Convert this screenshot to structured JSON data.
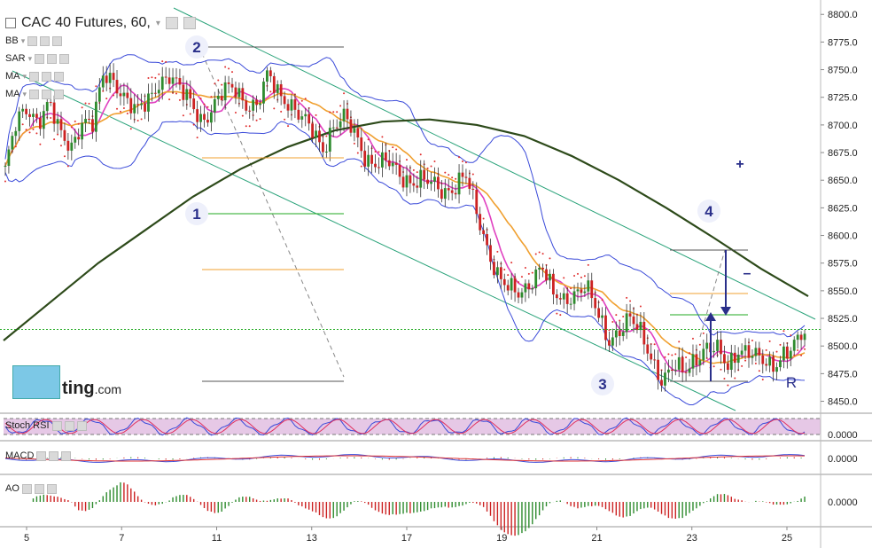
{
  "header": {
    "title": "CAC 40 Futures, 60,",
    "indicators": [
      "BB",
      "SAR",
      "MA",
      "MA"
    ]
  },
  "panes": {
    "stoch_label": "Stoch RSI",
    "macd_label": "MACD",
    "ao_label": "AO",
    "stoch_value": "0.0000",
    "macd_value": "0.0000",
    "ao_value": "0.0000"
  },
  "watermark": {
    "text": "ting",
    "suffix": ".com"
  },
  "annotations": {
    "wave1": "1",
    "wave2": "2",
    "wave3": "3",
    "wave4": "4",
    "plus": "+",
    "minus": "–",
    "r": "R"
  },
  "colors": {
    "candle_up": "#2e8b2e",
    "candle_down": "#cc2222",
    "bb": "#3a4ad9",
    "sar": "#e03030",
    "ma_fast": "#e040c0",
    "ma_mid": "#f0a030",
    "ma_slow": "#2d4a1a",
    "channel": "#2aa37a",
    "price_line": "#22aa22"
  },
  "chart_data": {
    "type": "candlestick",
    "x_ticks": [
      "5",
      "7",
      "11",
      "13",
      "17",
      "19",
      "21",
      "23",
      "25"
    ],
    "y_ticks": [
      "8800.0",
      "8775.0",
      "8750.0",
      "8725.0",
      "8700.0",
      "8675.0",
      "8650.0",
      "8625.0",
      "8600.0",
      "8575.0",
      "8550.0",
      "8525.0",
      "8500.0",
      "8475.0",
      "8450.0"
    ],
    "ylim": [
      8440,
      8805
    ],
    "close_path": [
      8660,
      8700,
      8715,
      8705,
      8720,
      8690,
      8680,
      8705,
      8700,
      8745,
      8740,
      8725,
      8710,
      8720,
      8740,
      8745,
      8730,
      8720,
      8705,
      8715,
      8730,
      8735,
      8720,
      8715,
      8745,
      8730,
      8720,
      8705,
      8695,
      8680,
      8700,
      8705,
      8690,
      8670,
      8665,
      8665,
      8655,
      8650,
      8650,
      8645,
      8640,
      8645,
      8655,
      8620,
      8590,
      8565,
      8550,
      8545,
      8560,
      8575,
      8545,
      8540,
      8550,
      8555,
      8530,
      8505,
      8515,
      8525,
      8510,
      8490,
      8470,
      8480,
      8475,
      8490,
      8500,
      8495,
      8480,
      8500,
      8495,
      8485,
      8480,
      8495,
      8500,
      8510
    ],
    "slow_ma": [
      8505,
      8540,
      8575,
      8605,
      8635,
      8660,
      8680,
      8695,
      8703,
      8705,
      8700,
      8690,
      8672,
      8650,
      8625,
      8598,
      8570,
      8545
    ],
    "horizontal_line": 8515
  }
}
